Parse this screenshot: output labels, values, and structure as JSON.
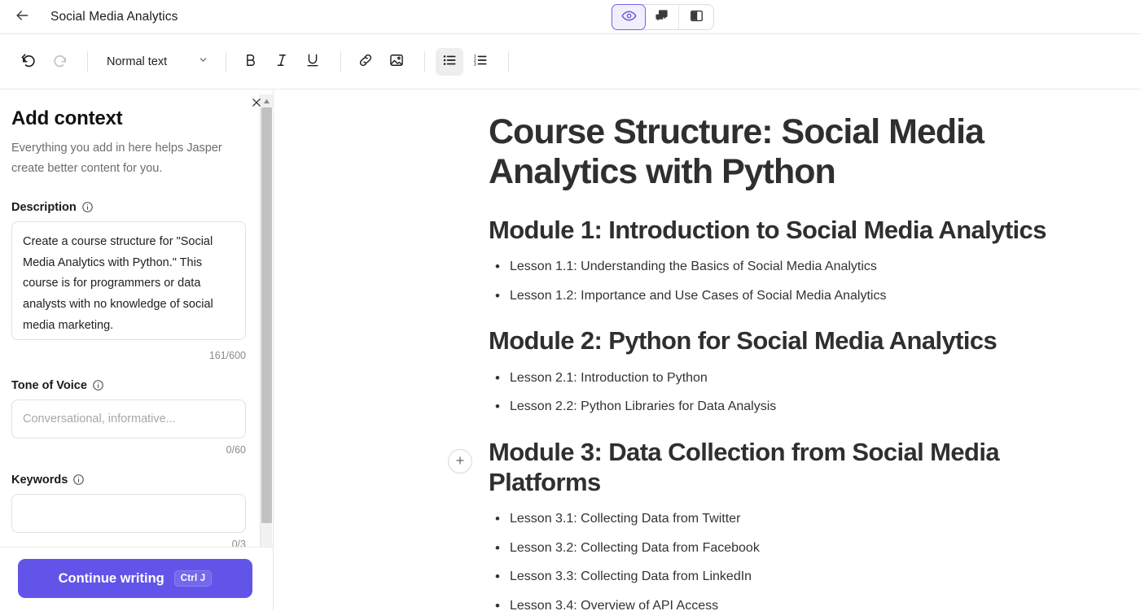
{
  "header": {
    "back_icon": "arrow-left-icon",
    "doc_title": "Social Media Analytics",
    "view_modes": [
      {
        "name": "preview",
        "icon": "eye-icon",
        "active": true
      },
      {
        "name": "comments",
        "icon": "comment-icon",
        "active": false
      },
      {
        "name": "panel-layout",
        "icon": "sidebar-panel-icon",
        "active": false
      }
    ]
  },
  "toolbar": {
    "undo_icon": "undo-icon",
    "redo_icon": "redo-icon",
    "style_value": "Normal text",
    "style_caret_icon": "chevron-down-icon",
    "bold_label": "B",
    "italic_label": "I",
    "underline_label": "U",
    "link_icon": "link-icon",
    "image_icon": "image-icon",
    "bullet_list_icon": "bulleted-list-icon",
    "numbered_list_icon": "numbered-list-icon"
  },
  "context_panel": {
    "title": "Add context",
    "subtitle": "Everything you add in here helps Jasper create better content for you.",
    "close_icon": "close-icon",
    "fields": [
      {
        "label": "Description",
        "info_icon": "info-icon",
        "value": "Create a course structure for \"Social Media Analytics with Python.\" This course is for programmers or data analysts with no knowledge of social media marketing.",
        "placeholder": "",
        "counter": "161/600"
      },
      {
        "label": "Tone of Voice",
        "info_icon": "info-icon",
        "value": "",
        "placeholder": "Conversational, informative...",
        "counter": "0/60"
      },
      {
        "label": "Keywords",
        "info_icon": "info-icon",
        "value": "",
        "placeholder": "",
        "counter": "0/3"
      }
    ],
    "cta": {
      "label": "Continue writing",
      "shortcut": "Ctrl J"
    }
  },
  "document": {
    "heading": "Course Structure: Social Media Analytics with Python",
    "add_block_icon": "plus-icon",
    "modules": [
      {
        "title": "Module 1: Introduction to Social Media Analytics",
        "lessons": [
          "Lesson 1.1: Understanding the Basics of Social Media Analytics",
          "Lesson 1.2: Importance and Use Cases of Social Media Analytics"
        ]
      },
      {
        "title": "Module 2: Python for Social Media Analytics",
        "lessons": [
          "Lesson 2.1: Introduction to Python",
          "Lesson 2.2: Python Libraries for Data Analysis"
        ]
      },
      {
        "title": "Module 3: Data Collection from Social Media Platforms",
        "lessons": [
          "Lesson 3.1: Collecting Data from Twitter",
          "Lesson 3.2: Collecting Data from Facebook",
          "Lesson 3.3: Collecting Data from LinkedIn",
          "Lesson 3.4: Overview of API Access"
        ]
      }
    ]
  },
  "colors": {
    "accent_purple": "#6254e8",
    "active_toggle_border": "#7c5cf0",
    "active_toggle_bg": "#f2effd",
    "toolbar_active_bg": "#eeeeee",
    "text_primary": "#2f2f2f",
    "text_muted": "#6d6d6d"
  }
}
